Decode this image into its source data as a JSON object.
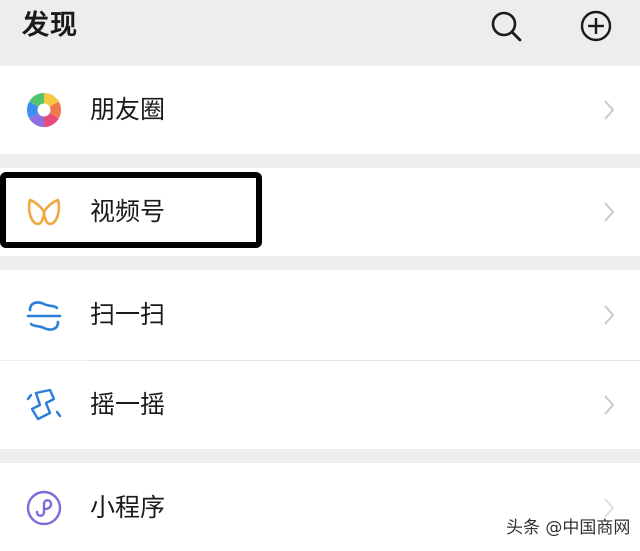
{
  "header": {
    "title": "发现",
    "search_icon": "search-icon",
    "add_icon": "plus-circle-icon"
  },
  "items": [
    {
      "label": "朋友圈",
      "icon": "moments-aperture-icon"
    },
    {
      "label": "视频号",
      "icon": "channels-icon"
    },
    {
      "label": "扫一扫",
      "icon": "scan-icon"
    },
    {
      "label": "摇一摇",
      "icon": "shake-icon"
    },
    {
      "label": "小程序",
      "icon": "mini-program-icon"
    }
  ],
  "watermark": "头条 @中国商网",
  "colors": {
    "background": "#ededed",
    "row": "#ffffff",
    "icon_blue": "#2a80d8",
    "channels_orange": "#f0a941",
    "mini_program_purple": "#7a6bd8",
    "highlight_border": "#000000"
  }
}
